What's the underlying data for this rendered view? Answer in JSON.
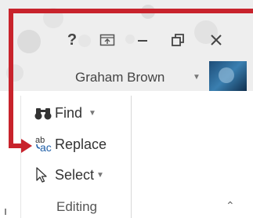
{
  "window": {
    "help_label": "?",
    "user_name": "Graham Brown",
    "icons": [
      "ribbon-display-options-icon",
      "minimize-icon",
      "restore-icon",
      "close-icon"
    ]
  },
  "editing_group": {
    "label": "Editing",
    "commands": {
      "find": "Find",
      "replace": "Replace",
      "select": "Select"
    }
  },
  "callout": {
    "color": "#c8232c",
    "target": "Replace"
  }
}
